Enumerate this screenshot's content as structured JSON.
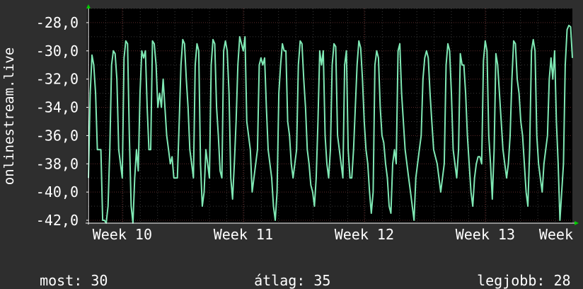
{
  "chart_data": {
    "type": "line",
    "ylabel": "onlinestream.live",
    "ylim": [
      -42.2,
      -27.0
    ],
    "yticks": [
      -28,
      -30,
      -32,
      -34,
      -36,
      -38,
      -40,
      -42
    ],
    "ytick_labels": [
      "-28,0",
      "-30,0",
      "-32,0",
      "-34,0",
      "-36,0",
      "-38,0",
      "-40,0",
      "-42,0"
    ],
    "xticks": [
      {
        "label": "Week 10",
        "pos": 0.07
      },
      {
        "label": "Week 11",
        "pos": 0.32
      },
      {
        "label": "Week 12",
        "pos": 0.57
      },
      {
        "label": "Week 13",
        "pos": 0.82
      },
      {
        "label": "Week",
        "pos": 1.07
      }
    ],
    "grid": true,
    "series": [
      {
        "color": "#7fe8b4",
        "values": [
          -39,
          -33,
          -30.3,
          -31,
          -33,
          -37,
          -37,
          -37,
          -42,
          -42,
          -42.2,
          -41,
          -37,
          -31,
          -30,
          -30.2,
          -32,
          -37,
          -38,
          -39,
          -30.5,
          -29.3,
          -29.5,
          -36,
          -41,
          -43.3,
          -39,
          -37,
          -38.5,
          -33,
          -30,
          -30.5,
          -30,
          -34,
          -37,
          -37,
          -29.3,
          -29.5,
          -31,
          -34,
          -33,
          -34,
          -32,
          -34,
          -36,
          -37,
          -38,
          -37.5,
          -39,
          -39,
          -39,
          -35,
          -31,
          -29.2,
          -29.5,
          -32,
          -34,
          -37,
          -38,
          -39,
          -31,
          -29.5,
          -30,
          -38,
          -41,
          -40,
          -37,
          -38,
          -39,
          -31,
          -29.2,
          -29.5,
          -34,
          -36,
          -38.5,
          -39,
          -30,
          -29.3,
          -30,
          -33,
          -39,
          -40.5,
          -38,
          -35,
          -31,
          -29,
          -29.5,
          -30,
          -29,
          -35,
          -36,
          -37,
          -40,
          -39,
          -38,
          -37,
          -31,
          -30.5,
          -31,
          -30.5,
          -34,
          -37,
          -38,
          -39,
          -41,
          -42,
          -40,
          -33,
          -31,
          -29.5,
          -30,
          -30,
          -35,
          -36,
          -38,
          -39,
          -38,
          -37,
          -31,
          -29.3,
          -29.5,
          -32,
          -34,
          -37,
          -38,
          -39.5,
          -40,
          -41,
          -39,
          -35,
          -30,
          -31,
          -30,
          -36,
          -38,
          -39,
          -37,
          -31,
          -29.5,
          -29.7,
          -36,
          -37,
          -38,
          -39,
          -31,
          -30,
          -37,
          -39,
          -39,
          -37,
          -34,
          -31,
          -29.3,
          -29.8,
          -32,
          -35,
          -37,
          -38,
          -40,
          -41.5,
          -40,
          -31,
          -30,
          -30.5,
          -34,
          -36,
          -36.5,
          -38,
          -39,
          -41,
          -41.5,
          -38,
          -37,
          -38,
          -30,
          -29.5,
          -33,
          -35,
          -37,
          -38,
          -39,
          -40,
          -41,
          -42,
          -39,
          -38,
          -37,
          -36,
          -32,
          -30.5,
          -30,
          -30.5,
          -33,
          -35,
          -37,
          -37.5,
          -38,
          -39,
          -40,
          -39,
          -38,
          -31,
          -29.5,
          -30,
          -33,
          -37,
          -38,
          -39,
          -37,
          -30.2,
          -31,
          -31,
          -33,
          -36,
          -38,
          -40,
          -41,
          -39,
          -38,
          -37.5,
          -37.5,
          -38,
          -30.7,
          -29.3,
          -30,
          -36,
          -38,
          -40.5,
          -37,
          -30.2,
          -31,
          -33,
          -35,
          -37,
          -38,
          -39,
          -38,
          -36,
          -32,
          -29.3,
          -29.5,
          -32,
          -33,
          -35,
          -36,
          -38,
          -40,
          -41,
          -37,
          -30,
          -29.2,
          -30,
          -36,
          -38,
          -39,
          -40,
          -38,
          -37,
          -36,
          -32,
          -30.5,
          -32,
          -30,
          -35,
          -38,
          -42,
          -40,
          -38,
          -31,
          -28.5,
          -28.2,
          -28.3,
          -30.5
        ]
      }
    ]
  },
  "stats": {
    "current_label": "most:",
    "current_value": "30",
    "average_label": "átlag:",
    "average_value": "35",
    "best_label": "legjobb:",
    "best_value": "28"
  }
}
